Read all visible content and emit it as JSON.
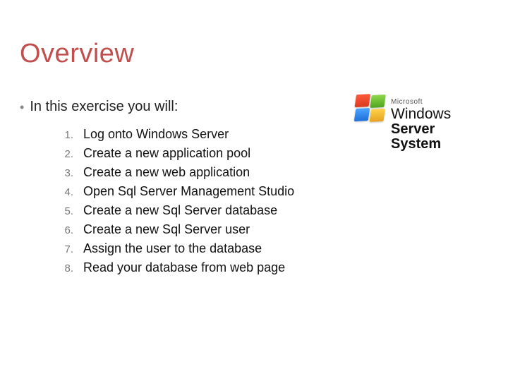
{
  "title": "Overview",
  "intro": "In this exercise you will:",
  "steps": [
    "Log onto Windows Server",
    "Create a new application pool",
    "Create a new web application",
    "Open Sql Server Management Studio",
    "Create a new Sql Server database",
    "Create a new Sql Server user",
    "Assign the user to the database",
    "Read your database from web page"
  ],
  "logo": {
    "brand_small": "Microsoft",
    "line1": "Windows",
    "line2": "Server System"
  }
}
